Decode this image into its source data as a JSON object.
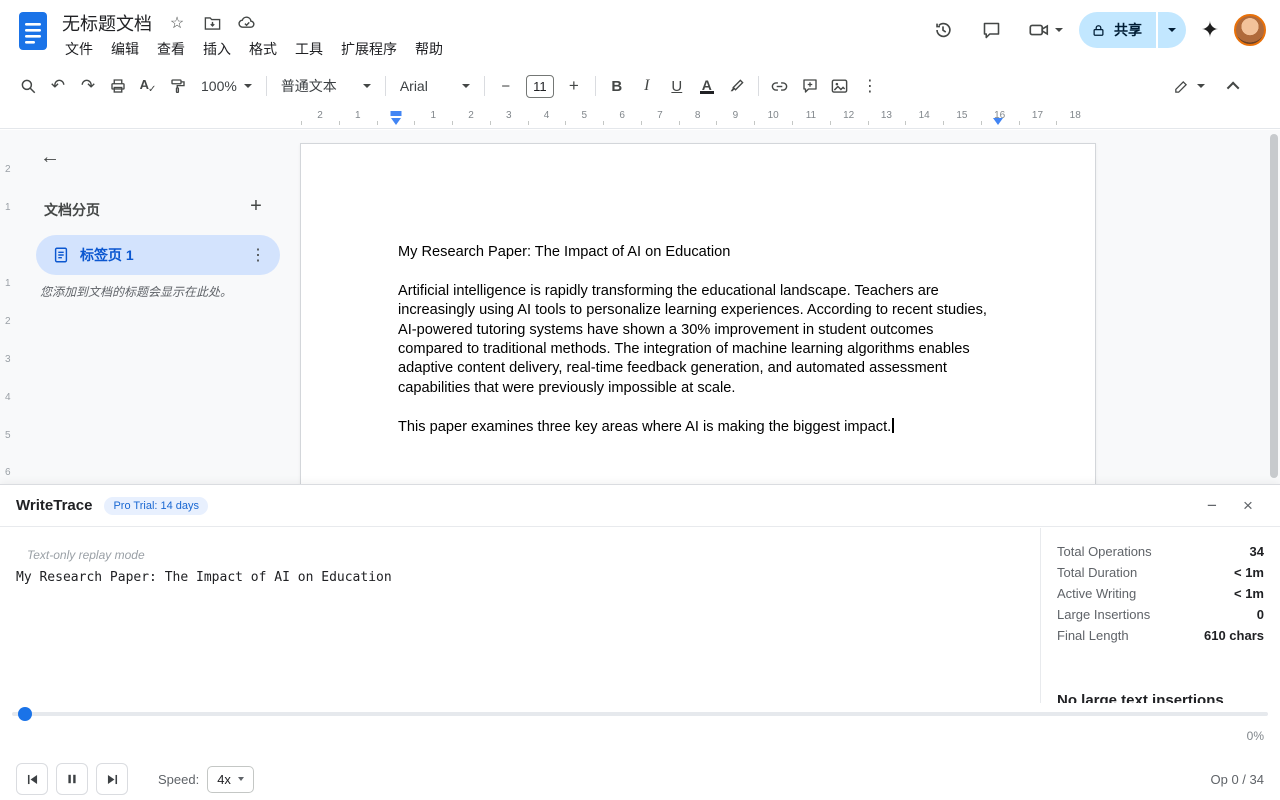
{
  "app": {
    "doc_title": "无标题文档",
    "menu_items": [
      "文件",
      "编辑",
      "查看",
      "插入",
      "格式",
      "工具",
      "扩展程序",
      "帮助"
    ],
    "share_label": "共享",
    "colors": {
      "accent_blue": "#1a73e8",
      "share_pill_bg": "#c2e7ff",
      "selected_tab_bg": "#d3e3fd",
      "selected_tab_text": "#0b57d0",
      "badge_bg": "#e8f0fe",
      "badge_text": "#1967d2"
    }
  },
  "icons": {
    "star": "☆",
    "undo": "↶",
    "redo": "↷",
    "more_vertical": "⋮",
    "back_arrow": "←",
    "minus": "−",
    "plus": "+",
    "add": "+",
    "sparkle": "✦",
    "bold": "B",
    "italic": "I",
    "underline": "U",
    "text_color": "A",
    "spell_letter": "A",
    "spell_check": "✓",
    "minimize": "−",
    "close": "×"
  },
  "toolbar": {
    "zoom": "100%",
    "paragraph_style": "普通文本",
    "font_name": "Arial",
    "font_size": "11"
  },
  "ruler": {
    "margin_numbers": [
      "2",
      "1"
    ],
    "numbers": [
      "1",
      "2",
      "3",
      "4",
      "5",
      "6",
      "7",
      "8",
      "9",
      "10",
      "11",
      "12",
      "13",
      "14",
      "15",
      "16",
      "17",
      "18"
    ]
  },
  "vertical_ruler": {
    "numbers": [
      "2",
      "1",
      "1",
      "2",
      "3",
      "4",
      "5",
      "6"
    ]
  },
  "sidebar": {
    "tabs_title": "文档分页",
    "tab_label": "标签页 1",
    "hint": "您添加到文档的标题会显示在此处。"
  },
  "document": {
    "title": "My Research Paper: The Impact of AI on Education",
    "body": "Artificial intelligence is rapidly transforming the educational landscape. Teachers are increasingly using AI tools to personalize learning experiences. According to recent studies, AI-powered tutoring systems have shown a 30% improvement in student outcomes compared to traditional methods. The integration of machine learning algorithms enables adaptive content delivery, real-time feedback generation, and automated assessment capabilities that were previously impossible at scale.",
    "closing": "This paper examines three key areas where AI is making the biggest impact."
  },
  "writetrace": {
    "title": "WriteTrace",
    "badge": "Pro Trial: 14 days",
    "replay_mode_label": "Text-only replay mode",
    "replay_text": "My Research Paper: The Impact of AI on Education",
    "stats": [
      {
        "label": "Total Operations",
        "value": "34"
      },
      {
        "label": "Total Duration",
        "value": "< 1m"
      },
      {
        "label": "Active Writing",
        "value": "< 1m"
      },
      {
        "label": "Large Insertions",
        "value": "0"
      },
      {
        "label": "Final Length",
        "value": "610 chars"
      }
    ],
    "clipped_heading": "No large text insertions",
    "progress_percent": "0%",
    "speed_label": "Speed:",
    "speed_value": "4x",
    "op_counter": "Op 0 / 34"
  }
}
